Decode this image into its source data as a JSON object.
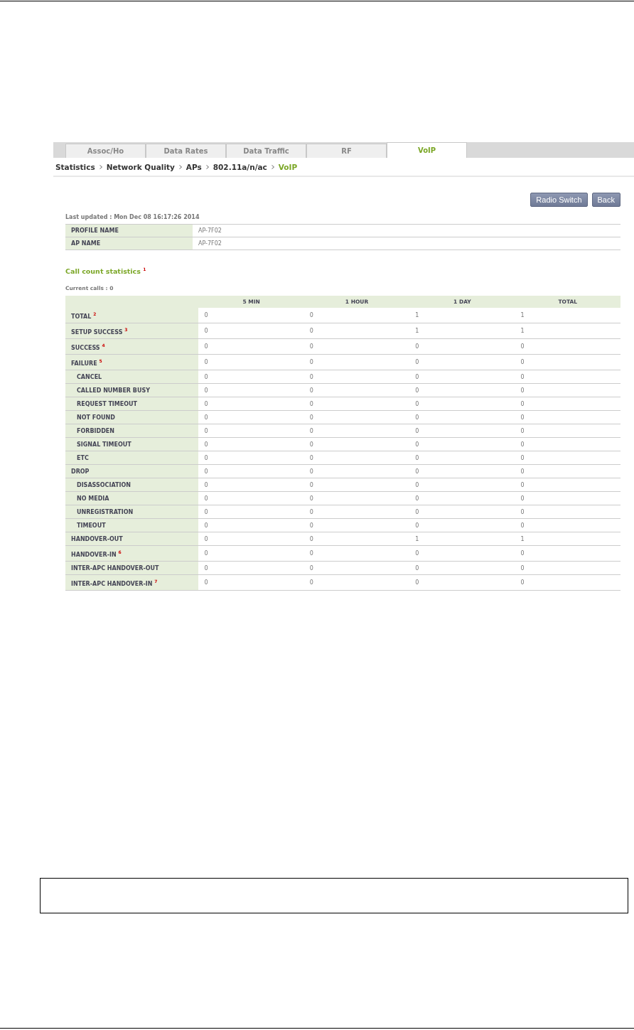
{
  "tabs": [
    {
      "label": "Assoc/Ho",
      "selected": false
    },
    {
      "label": "Data Rates",
      "selected": false
    },
    {
      "label": "Data Traffic",
      "selected": false
    },
    {
      "label": "RF",
      "selected": false
    },
    {
      "label": "VoIP",
      "selected": true
    }
  ],
  "breadcrumb": [
    "Statistics",
    "Network Quality",
    "APs",
    "802.11a/n/ac",
    "VoIP"
  ],
  "buttons": [
    "Radio Switch",
    "Back"
  ],
  "last_updated": "Last updated : Mon Dec 08 16:17:26 2014",
  "info": [
    {
      "label": "PROFILE NAME",
      "value": "AP-7F02"
    },
    {
      "label": "AP NAME",
      "value": "AP-7F02"
    }
  ],
  "section_title": "Call count statistics $^{1}$",
  "current_calls": "Current calls : 0",
  "columns": [
    "5 MIN",
    "1 HOUR",
    "1 DAY",
    "TOTAL"
  ],
  "rows": [
    {
      "kind": "main",
      "label": "TOTAL $^{2}$",
      "values": [
        "0",
        "0",
        "1",
        "1"
      ]
    },
    {
      "kind": "main",
      "label": "SETUP SUCCESS $^{3}$",
      "values": [
        "0",
        "0",
        "1",
        "1"
      ]
    },
    {
      "kind": "main",
      "label": "SUCCESS $^{4}$",
      "values": [
        "0",
        "0",
        "0",
        "0"
      ]
    },
    {
      "kind": "main",
      "label": "FAILURE $^{5}$",
      "values": [
        "0",
        "0",
        "0",
        "0"
      ]
    },
    {
      "kind": "sub",
      "label": "CANCEL",
      "values": [
        "0",
        "0",
        "0",
        "0"
      ]
    },
    {
      "kind": "sub",
      "label": "CALLED NUMBER BUSY",
      "values": [
        "0",
        "0",
        "0",
        "0"
      ]
    },
    {
      "kind": "sub",
      "label": "REQUEST TIMEOUT",
      "values": [
        "0",
        "0",
        "0",
        "0"
      ]
    },
    {
      "kind": "sub",
      "label": "NOT FOUND",
      "values": [
        "0",
        "0",
        "0",
        "0"
      ]
    },
    {
      "kind": "sub",
      "label": "FORBIDDEN",
      "values": [
        "0",
        "0",
        "0",
        "0"
      ]
    },
    {
      "kind": "sub",
      "label": "SIGNAL TIMEOUT",
      "values": [
        "0",
        "0",
        "0",
        "0"
      ]
    },
    {
      "kind": "sub",
      "label": "ETC",
      "values": [
        "0",
        "0",
        "0",
        "0"
      ]
    },
    {
      "kind": "plain",
      "label": "DROP",
      "values": [
        "0",
        "0",
        "0",
        "0"
      ]
    },
    {
      "kind": "sub",
      "label": "DISASSOCIATION",
      "values": [
        "0",
        "0",
        "0",
        "0"
      ]
    },
    {
      "kind": "sub",
      "label": "NO MEDIA",
      "values": [
        "0",
        "0",
        "0",
        "0"
      ]
    },
    {
      "kind": "sub",
      "label": "UNREGISTRATION",
      "values": [
        "0",
        "0",
        "0",
        "0"
      ]
    },
    {
      "kind": "sub",
      "label": "TIMEOUT",
      "values": [
        "0",
        "0",
        "0",
        "0"
      ]
    },
    {
      "kind": "plain",
      "label": "HANDOVER-OUT",
      "values": [
        "0",
        "0",
        "1",
        "1"
      ]
    },
    {
      "kind": "main",
      "label": "HANDOVER-IN $^{6}$",
      "values": [
        "0",
        "0",
        "0",
        "0"
      ]
    },
    {
      "kind": "plain",
      "label": "INTER-APC HANDOVER-OUT",
      "values": [
        "0",
        "0",
        "0",
        "0"
      ]
    },
    {
      "kind": "main",
      "label": "INTER-APC HANDOVER-IN $^{7}$",
      "values": [
        "0",
        "0",
        "0",
        "0"
      ]
    }
  ]
}
